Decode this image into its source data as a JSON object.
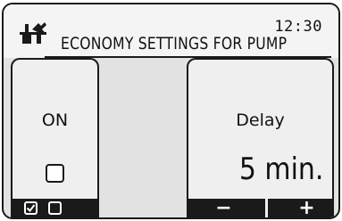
{
  "header": {
    "icon": "service-tools-icon",
    "time": "12:30",
    "title": "ECONOMY SETTINGS FOR PUMP"
  },
  "left_panel": {
    "label": "ON",
    "checkbox_checked": false
  },
  "right_panel": {
    "label": "Delay",
    "value": "5 min."
  },
  "softkeys": {
    "left": [
      "checkbox-checked-icon",
      "checkbox-empty-icon"
    ],
    "decrease": "−",
    "increase": "+"
  }
}
